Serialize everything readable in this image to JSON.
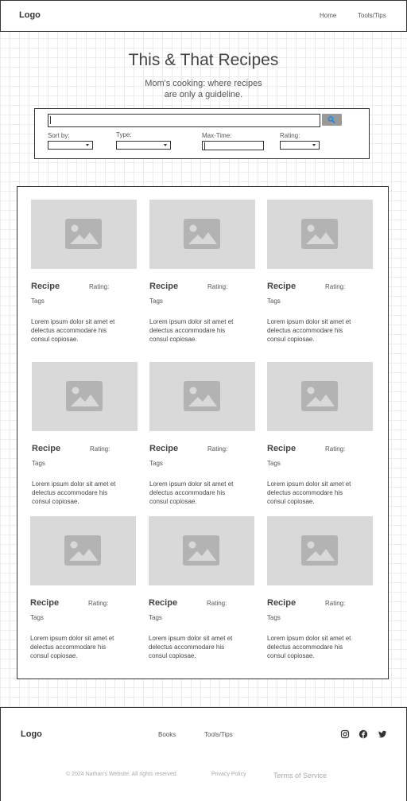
{
  "header": {
    "logo": "Logo",
    "nav": [
      "Home",
      "Tools/Tips"
    ]
  },
  "hero": {
    "title": "This & That Recipes",
    "subtitle_line1": "Mom's cooking: where recipes",
    "subtitle_line2": "are only a guideline."
  },
  "search": {
    "value": "",
    "button_icon": "magnifier-icon",
    "filters": {
      "sort": "Sort by:",
      "type": "Type:",
      "max_time": "Max-Time:",
      "rating": "Rating:"
    }
  },
  "recipes": [
    {
      "title": "Recipe",
      "rating": "Rating:",
      "tags": "Tags",
      "desc1": "Lorem ipsum dolor sit amet et",
      "desc2": "delectus accommodare his",
      "desc3": "consul copiosae."
    },
    {
      "title": "Recipe",
      "rating": "Rating:",
      "tags": "Tags",
      "desc1": "Lorem ipsum dolor sit amet et",
      "desc2": "delectus accommodare his",
      "desc3": "consul copiosae."
    },
    {
      "title": "Recipe",
      "rating": "Rating:",
      "tags": "Tags",
      "desc1": "Lorem ipsum dolor sit amet et",
      "desc2": "delectus accommodare his",
      "desc3": "consul copiosae."
    },
    {
      "title": "Recipe",
      "rating": "Rating:",
      "tags": "Tags",
      "desc1": "Lorem ipsum dolor sit amet et",
      "desc2": "delectus accommodare his",
      "desc3": "consul copiosae."
    },
    {
      "title": "Recipe",
      "rating": "Rating:",
      "tags": "Tags",
      "desc1": "Lorem ipsum dolor sit amet et",
      "desc2": "delectus accommodare his",
      "desc3": "consul copiosae."
    },
    {
      "title": "Recipe",
      "rating": "Rating:",
      "tags": "Tags",
      "desc1": "Lorem ipsum dolor sit amet et",
      "desc2": "delectus accommodare his",
      "desc3": "consul copiosae."
    },
    {
      "title": "Recipe",
      "rating": "Rating:",
      "tags": "Tags",
      "desc1": "Lorem ipsum dolor sit amet et",
      "desc2": "delectus accommodare his",
      "desc3": "consul copiosae."
    },
    {
      "title": "Recipe",
      "rating": "Rating:",
      "tags": "Tags",
      "desc1": "Lorem ipsum dolor sit amet et",
      "desc2": "delectus accommodare his",
      "desc3": "consul copiosae."
    },
    {
      "title": "Recipe",
      "rating": "Rating:",
      "tags": "Tags",
      "desc1": "Lorem ipsum dolor sit amet et",
      "desc2": "delectus accommodare his",
      "desc3": "consul copiosae."
    }
  ],
  "footer": {
    "logo": "Logo",
    "links": [
      "Books",
      "Tools/Tips"
    ],
    "social": [
      "instagram-icon",
      "facebook-icon",
      "twitter-icon"
    ],
    "copyright": "© 2024 Nathan's Website. All rights reserved.",
    "privacy": "Privacy Policy",
    "terms": "Terms of Service"
  },
  "colors": {
    "image_placeholder": "#d9d9d9",
    "search_button": "#999999",
    "search_icon": "#1e88e5"
  }
}
